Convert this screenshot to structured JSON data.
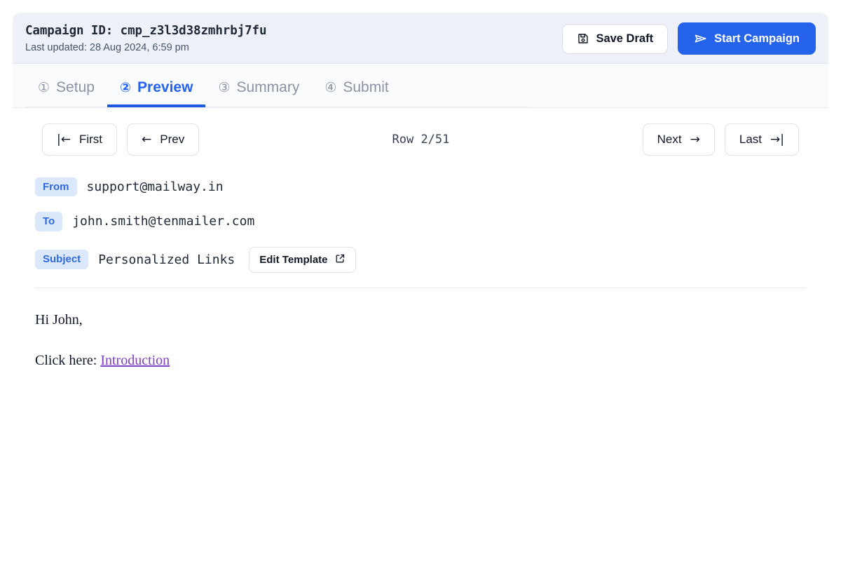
{
  "header": {
    "campaign_id_label": "Campaign ID: cmp_z3l3d38zmhrbj7fu",
    "last_updated": "Last updated: 28 Aug 2024, 6:59 pm",
    "save_draft_label": "Save Draft",
    "start_campaign_label": "Start Campaign",
    "save_icon": "floppy-disk-icon",
    "start_icon": "send-icon",
    "accent_color": "#2563eb",
    "band_color": "#eef1f7"
  },
  "tabs": [
    {
      "num": "①",
      "label": "Setup",
      "active": false
    },
    {
      "num": "②",
      "label": "Preview",
      "active": true
    },
    {
      "num": "③",
      "label": "Summary",
      "active": false
    },
    {
      "num": "④",
      "label": "Submit",
      "active": false
    }
  ],
  "pager": {
    "first_label": "First",
    "first_arrow": "|←",
    "prev_label": "Prev",
    "prev_arrow": "←",
    "row_status": "Row 2/51",
    "next_label": "Next",
    "next_arrow": "→",
    "last_label": "Last",
    "last_arrow": "→|"
  },
  "email": {
    "from_badge": "From",
    "from_value": "support@mailway.in",
    "to_badge": "To",
    "to_value": "john.smith@tenmailer.com",
    "subject_badge": "Subject",
    "subject_value": "Personalized Links",
    "edit_template_label": "Edit Template",
    "edit_template_icon": "external-link-icon",
    "badge_bg": "#dbe7fb",
    "badge_color": "#2f6ae0",
    "body_greeting": "Hi John,",
    "body_line_prefix": "Click here: ",
    "body_link_text": "Introduction",
    "link_color": "#7b3fbf"
  }
}
